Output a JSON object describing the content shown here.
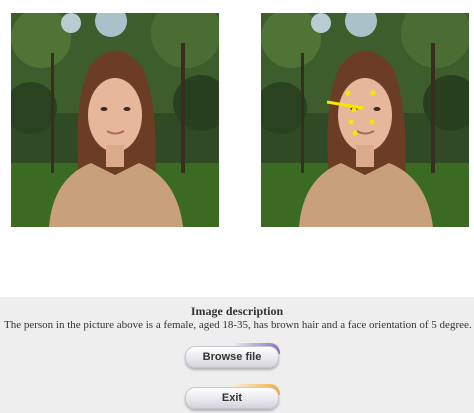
{
  "description": {
    "title": "Image description",
    "text": "The person in the picture above is a female, aged 18-35, has brown hair and a face orientation of 5 degree."
  },
  "buttons": {
    "browse_label": "Browse file",
    "exit_label": "Exit"
  },
  "colors": {
    "landmark_dots": "#f5e800",
    "orientation_line": "#f5e800",
    "browse_accent": "#8a70c0",
    "exit_accent": "#f0b03e"
  }
}
